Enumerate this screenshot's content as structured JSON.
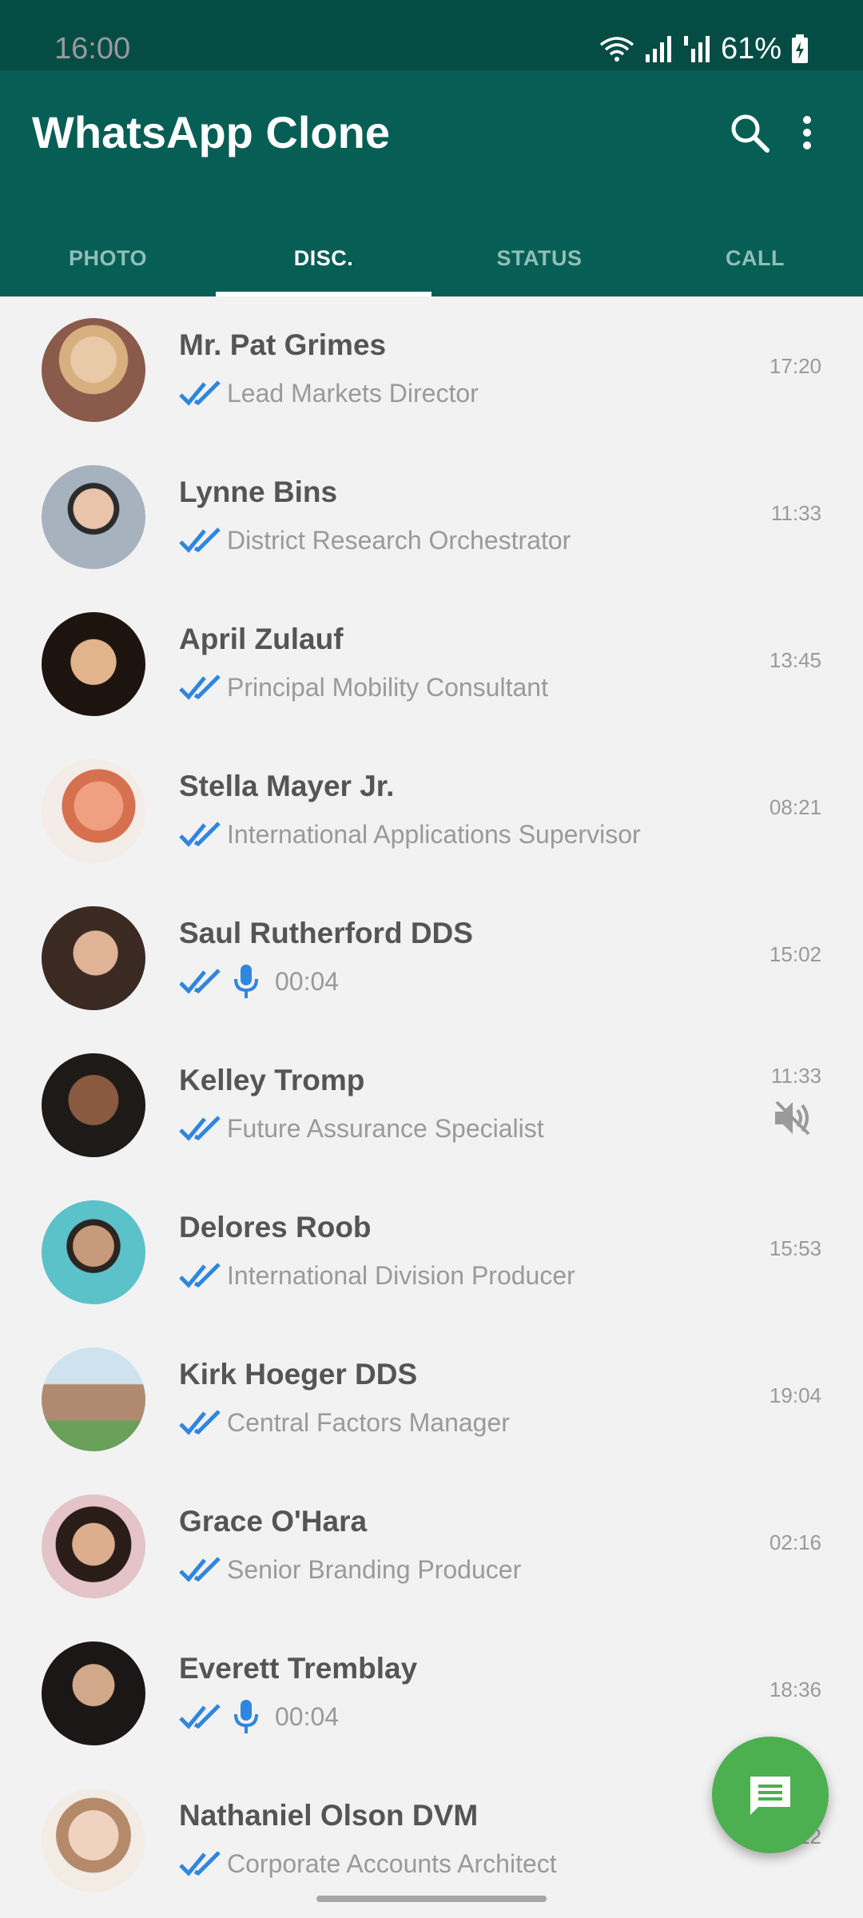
{
  "status_bar": {
    "time": "16:00",
    "battery": "61%"
  },
  "app_bar": {
    "title": "WhatsApp Clone",
    "search_icon": "search-icon",
    "menu_icon": "more-vert-icon"
  },
  "tabs": [
    {
      "label": "PHOTO",
      "active": false
    },
    {
      "label": "DISC.",
      "active": true
    },
    {
      "label": "STATUS",
      "active": false
    },
    {
      "label": "CALL",
      "active": false
    }
  ],
  "colors": {
    "app_bar": "#075e54",
    "status_bar": "#054d44",
    "tick_blue": "#2f86de",
    "fab": "#4caf50"
  },
  "chats": [
    {
      "name": "Mr. Pat Grimes",
      "message": "Lead Markets Director",
      "time": "17:20",
      "type": "text",
      "muted": false
    },
    {
      "name": "Lynne Bins",
      "message": "District Research Orchestrator",
      "time": "11:33",
      "type": "text",
      "muted": false
    },
    {
      "name": "April Zulauf",
      "message": "Principal Mobility Consultant",
      "time": "13:45",
      "type": "text",
      "muted": false
    },
    {
      "name": "Stella Mayer Jr.",
      "message": "International Applications Supervisor",
      "time": "08:21",
      "type": "text",
      "muted": false
    },
    {
      "name": "Saul Rutherford DDS",
      "message": "00:04",
      "time": "15:02",
      "type": "voice",
      "muted": false
    },
    {
      "name": "Kelley Tromp",
      "message": "Future Assurance Specialist",
      "time": "11:33",
      "type": "text",
      "muted": true
    },
    {
      "name": "Delores Roob",
      "message": "International Division Producer",
      "time": "15:53",
      "type": "text",
      "muted": false
    },
    {
      "name": "Kirk Hoeger DDS",
      "message": "Central Factors Manager",
      "time": "19:04",
      "type": "text",
      "muted": false
    },
    {
      "name": "Grace O'Hara",
      "message": "Senior Branding Producer",
      "time": "02:16",
      "type": "text",
      "muted": false
    },
    {
      "name": "Everett Tremblay",
      "message": "00:04",
      "time": "18:36",
      "type": "voice",
      "muted": false
    },
    {
      "name": "Nathaniel Olson DVM",
      "message": "Corporate Accounts Architect",
      "time": "12:12",
      "type": "text",
      "muted": false
    }
  ],
  "fab": {
    "icon": "new-chat-icon"
  }
}
